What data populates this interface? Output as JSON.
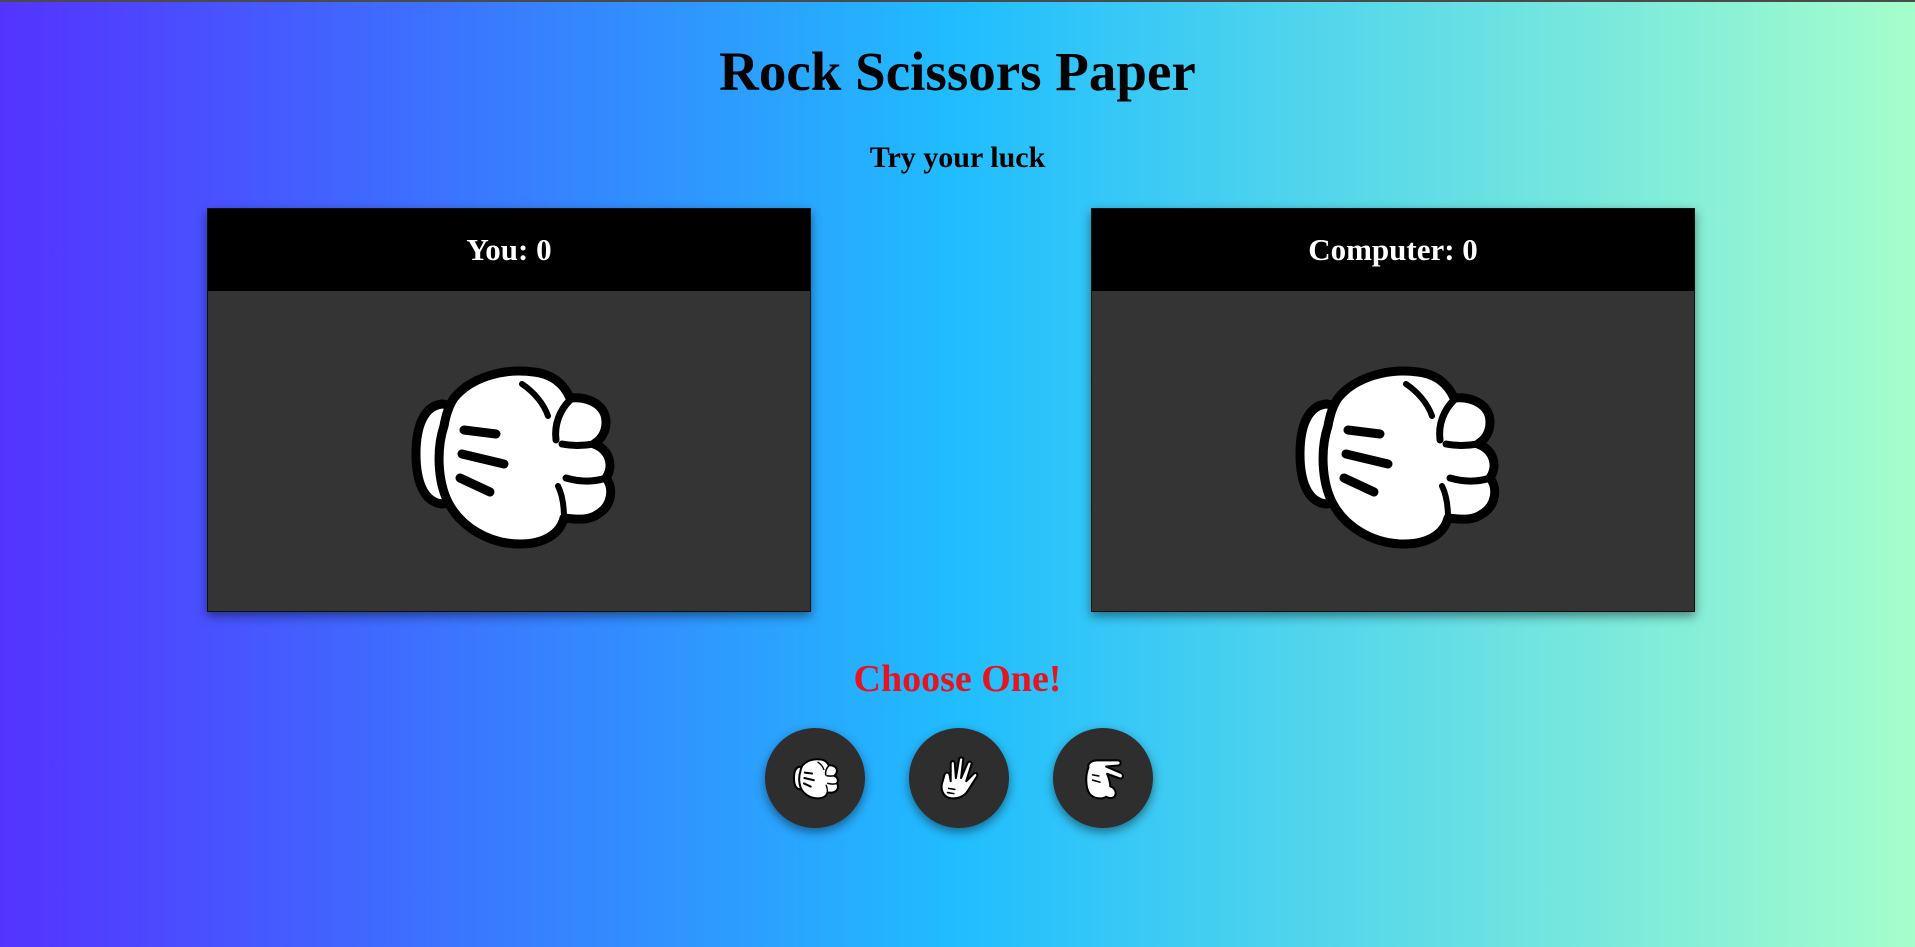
{
  "header": {
    "title": "Rock Scissors Paper",
    "subtitle": "Try your luck"
  },
  "player": {
    "label": "You: 0",
    "hand_icon": "rock-fist-icon"
  },
  "computer": {
    "label": "Computer: 0",
    "hand_icon": "rock-fist-icon"
  },
  "prompt": {
    "text": "Choose One!",
    "color": "#e5141e"
  },
  "choices": [
    {
      "name": "rock",
      "icon": "rock-fist-icon"
    },
    {
      "name": "paper",
      "icon": "paper-hand-icon"
    },
    {
      "name": "scissors",
      "icon": "scissors-hand-icon"
    }
  ],
  "colors": {
    "gradient_start": "#5433ff",
    "gradient_mid": "#20bdff",
    "gradient_end": "#a5fecb",
    "panel_bg": "#353435",
    "panel_header_bg": "#000000",
    "button_bg": "#2e2e2e"
  }
}
